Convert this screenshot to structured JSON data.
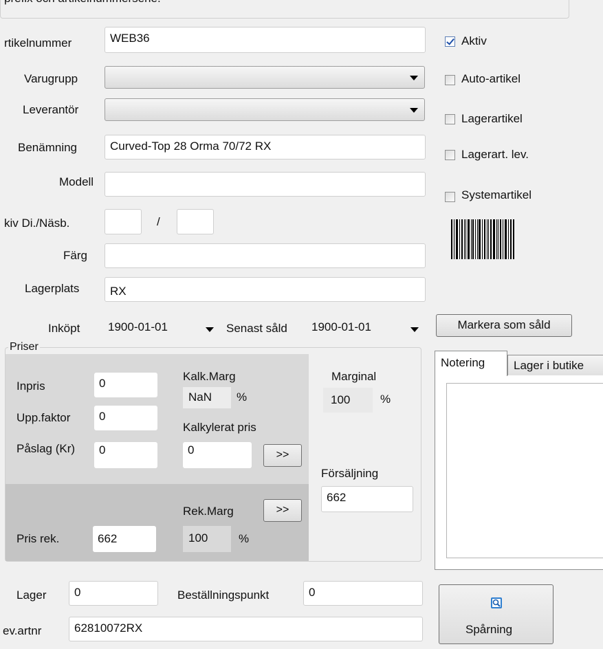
{
  "header_text": "prefix och artikelnummerserie.",
  "form": {
    "artikelnummer": {
      "label": "rtikelnummer",
      "value": "WEB36"
    },
    "varugrupp": {
      "label": "Varugrupp",
      "value": ""
    },
    "leverantor": {
      "label": "Leverantör",
      "value": ""
    },
    "benamning": {
      "label": "Benämning",
      "value": "Curved-Top 28 Orma 70/72 RX"
    },
    "modell": {
      "label": "Modell",
      "value": ""
    },
    "dinasb": {
      "label": "kiv Di./Näsb.",
      "value1": "",
      "separator": "/",
      "value2": ""
    },
    "farg": {
      "label": "Färg",
      "value": ""
    },
    "lagerplats": {
      "label": "Lagerplats",
      "value": "RX"
    },
    "inkopt": {
      "label": "Inköpt",
      "value": "1900-01-01"
    },
    "senast_sald": {
      "label": "Senast såld",
      "value": "1900-01-01"
    }
  },
  "checkboxes": [
    {
      "label": "Aktiv",
      "checked": true
    },
    {
      "label": "Auto-artikel",
      "checked": false
    },
    {
      "label": "Lagerartikel",
      "checked": false
    },
    {
      "label": "Lagerart. lev.",
      "checked": false
    },
    {
      "label": "Systemartikel",
      "checked": false
    }
  ],
  "markera_button": "Markera som såld",
  "priser": {
    "title": "Priser",
    "inpris": {
      "label": "Inpris",
      "value": "0"
    },
    "uppfaktor": {
      "label": "Upp.faktor",
      "value": "0"
    },
    "paslag": {
      "label": "Påslag (Kr)",
      "value": "0"
    },
    "kalk_marg": {
      "label": "Kalk.Marg",
      "value": "NaN",
      "unit": "%"
    },
    "kalkylerat_pris": {
      "label": "Kalkylerat pris",
      "value": "0",
      "button": ">>"
    },
    "marginal": {
      "label": "Marginal",
      "value": "100",
      "unit": "%"
    },
    "forsaljning": {
      "label": "Försäljning",
      "value": "662"
    },
    "rek_marg": {
      "label": "Rek.Marg",
      "value": "100",
      "unit": "%",
      "button": ">>"
    },
    "pris_rek": {
      "label": "Pris rek.",
      "value": "662"
    }
  },
  "tabs": [
    "Notering",
    "Lager i butike"
  ],
  "lager": {
    "label": "Lager",
    "value": "0"
  },
  "bestallningspunkt": {
    "label": "Beställningspunkt",
    "value": "0"
  },
  "levartnr": {
    "label": "ev.artnr",
    "value": "62810072RX"
  },
  "sparning_button": "Spårning",
  "colors": {
    "background": "#f0f0f0",
    "panel_light": "#d9d9d9",
    "panel_dark": "#c4c4c4",
    "check_blue": "#1d4fa8"
  }
}
